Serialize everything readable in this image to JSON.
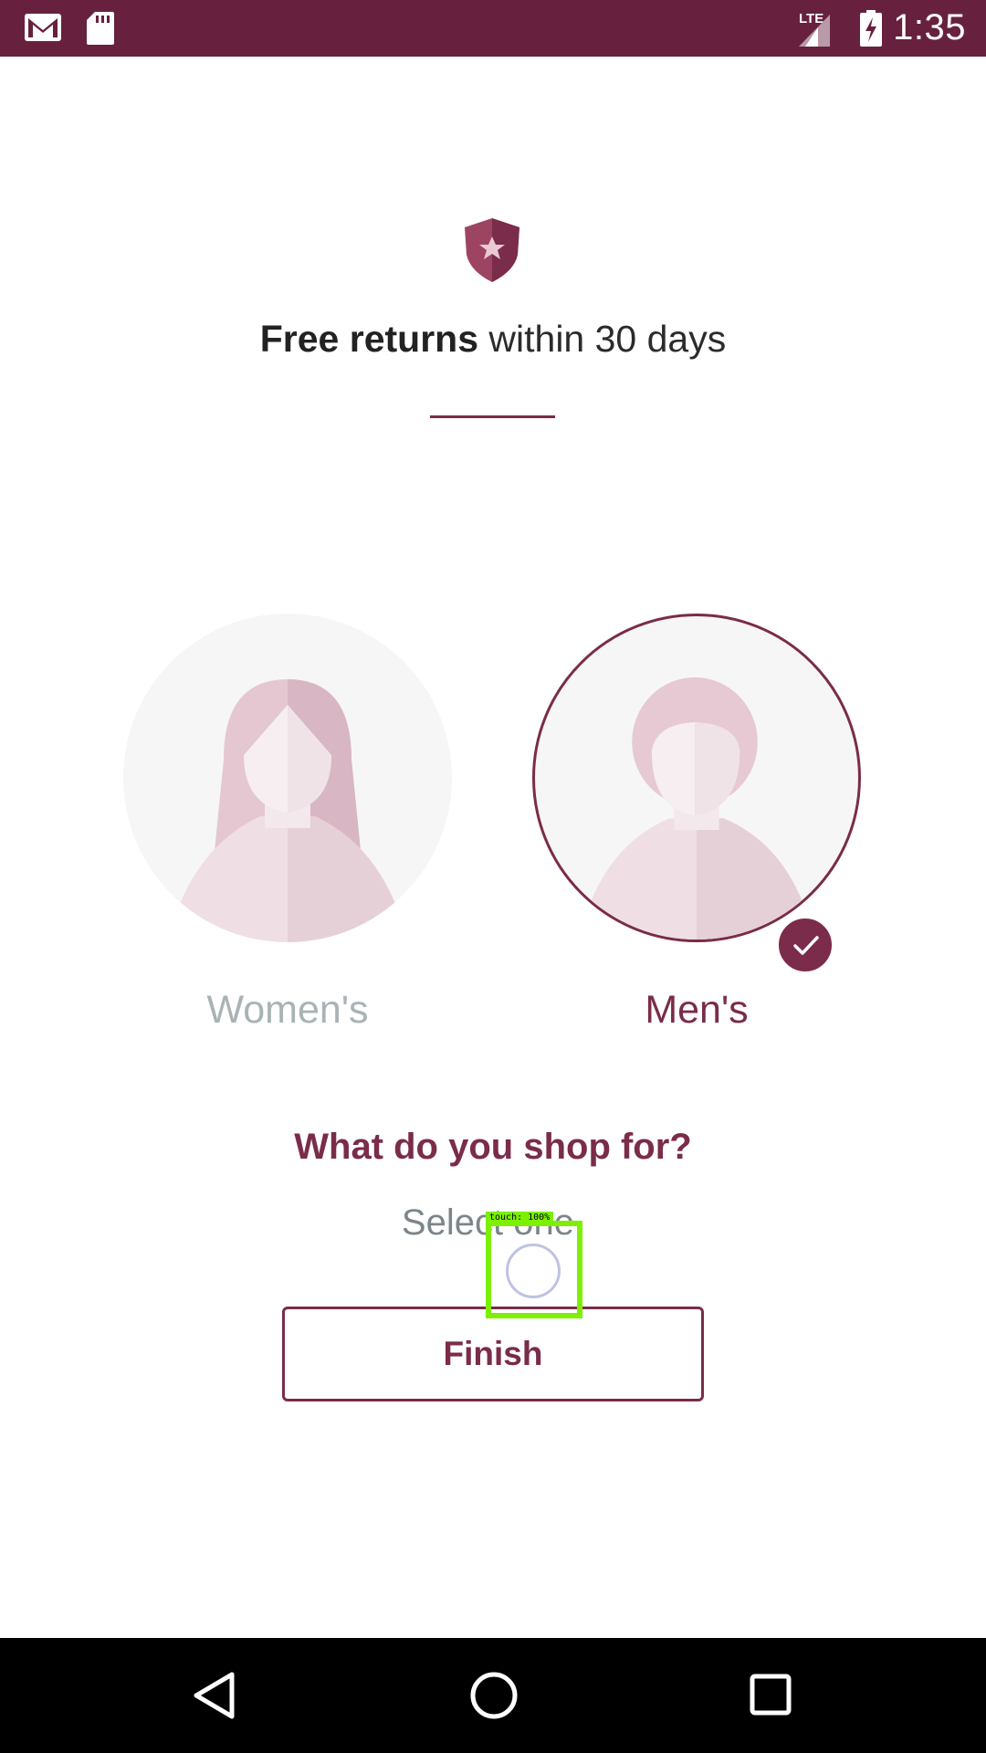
{
  "status_bar": {
    "time": "1:35",
    "network": "LTE",
    "icons": [
      "gmail-icon",
      "sd-card-icon",
      "lte-signal-icon",
      "battery-charging-icon"
    ]
  },
  "colors": {
    "brand": "#67213f",
    "accent": "#7a2c4a",
    "muted_label": "#a9b3b6",
    "subtitle": "#7b858a"
  },
  "banner": {
    "icon": "shield-star-icon",
    "title_bold": "Free returns",
    "title_rest": " within 30 days"
  },
  "choices": [
    {
      "label": "Women's",
      "icon": "woman-avatar-icon",
      "selected": false
    },
    {
      "label": "Men's",
      "icon": "man-avatar-icon",
      "selected": true
    }
  ],
  "prompt": {
    "question": "What do you shop for?",
    "hint": "Select one."
  },
  "finish_label": "Finish",
  "touch_overlay": {
    "label": "touch: 100%"
  },
  "nav_bar": {
    "icons": [
      "back-icon",
      "home-icon",
      "recents-icon"
    ]
  }
}
